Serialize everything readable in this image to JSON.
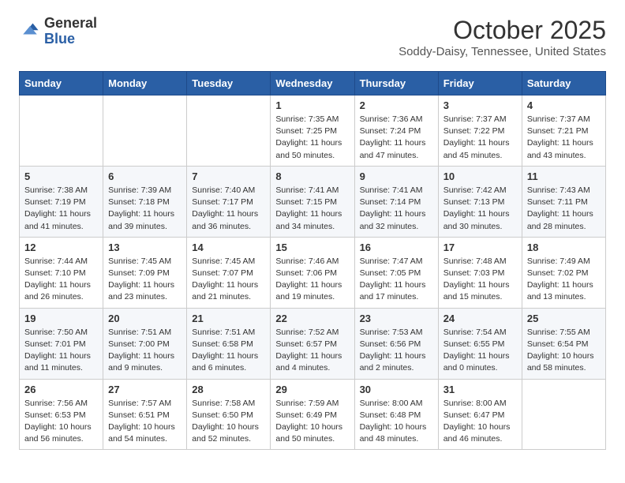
{
  "header": {
    "logo": {
      "general": "General",
      "blue": "Blue"
    },
    "title": "October 2025",
    "location": "Soddy-Daisy, Tennessee, United States"
  },
  "weekdays": [
    "Sunday",
    "Monday",
    "Tuesday",
    "Wednesday",
    "Thursday",
    "Friday",
    "Saturday"
  ],
  "weeks": [
    [
      {
        "day": "",
        "info": ""
      },
      {
        "day": "",
        "info": ""
      },
      {
        "day": "",
        "info": ""
      },
      {
        "day": "1",
        "info": "Sunrise: 7:35 AM\nSunset: 7:25 PM\nDaylight: 11 hours\nand 50 minutes."
      },
      {
        "day": "2",
        "info": "Sunrise: 7:36 AM\nSunset: 7:24 PM\nDaylight: 11 hours\nand 47 minutes."
      },
      {
        "day": "3",
        "info": "Sunrise: 7:37 AM\nSunset: 7:22 PM\nDaylight: 11 hours\nand 45 minutes."
      },
      {
        "day": "4",
        "info": "Sunrise: 7:37 AM\nSunset: 7:21 PM\nDaylight: 11 hours\nand 43 minutes."
      }
    ],
    [
      {
        "day": "5",
        "info": "Sunrise: 7:38 AM\nSunset: 7:19 PM\nDaylight: 11 hours\nand 41 minutes."
      },
      {
        "day": "6",
        "info": "Sunrise: 7:39 AM\nSunset: 7:18 PM\nDaylight: 11 hours\nand 39 minutes."
      },
      {
        "day": "7",
        "info": "Sunrise: 7:40 AM\nSunset: 7:17 PM\nDaylight: 11 hours\nand 36 minutes."
      },
      {
        "day": "8",
        "info": "Sunrise: 7:41 AM\nSunset: 7:15 PM\nDaylight: 11 hours\nand 34 minutes."
      },
      {
        "day": "9",
        "info": "Sunrise: 7:41 AM\nSunset: 7:14 PM\nDaylight: 11 hours\nand 32 minutes."
      },
      {
        "day": "10",
        "info": "Sunrise: 7:42 AM\nSunset: 7:13 PM\nDaylight: 11 hours\nand 30 minutes."
      },
      {
        "day": "11",
        "info": "Sunrise: 7:43 AM\nSunset: 7:11 PM\nDaylight: 11 hours\nand 28 minutes."
      }
    ],
    [
      {
        "day": "12",
        "info": "Sunrise: 7:44 AM\nSunset: 7:10 PM\nDaylight: 11 hours\nand 26 minutes."
      },
      {
        "day": "13",
        "info": "Sunrise: 7:45 AM\nSunset: 7:09 PM\nDaylight: 11 hours\nand 23 minutes."
      },
      {
        "day": "14",
        "info": "Sunrise: 7:45 AM\nSunset: 7:07 PM\nDaylight: 11 hours\nand 21 minutes."
      },
      {
        "day": "15",
        "info": "Sunrise: 7:46 AM\nSunset: 7:06 PM\nDaylight: 11 hours\nand 19 minutes."
      },
      {
        "day": "16",
        "info": "Sunrise: 7:47 AM\nSunset: 7:05 PM\nDaylight: 11 hours\nand 17 minutes."
      },
      {
        "day": "17",
        "info": "Sunrise: 7:48 AM\nSunset: 7:03 PM\nDaylight: 11 hours\nand 15 minutes."
      },
      {
        "day": "18",
        "info": "Sunrise: 7:49 AM\nSunset: 7:02 PM\nDaylight: 11 hours\nand 13 minutes."
      }
    ],
    [
      {
        "day": "19",
        "info": "Sunrise: 7:50 AM\nSunset: 7:01 PM\nDaylight: 11 hours\nand 11 minutes."
      },
      {
        "day": "20",
        "info": "Sunrise: 7:51 AM\nSunset: 7:00 PM\nDaylight: 11 hours\nand 9 minutes."
      },
      {
        "day": "21",
        "info": "Sunrise: 7:51 AM\nSunset: 6:58 PM\nDaylight: 11 hours\nand 6 minutes."
      },
      {
        "day": "22",
        "info": "Sunrise: 7:52 AM\nSunset: 6:57 PM\nDaylight: 11 hours\nand 4 minutes."
      },
      {
        "day": "23",
        "info": "Sunrise: 7:53 AM\nSunset: 6:56 PM\nDaylight: 11 hours\nand 2 minutes."
      },
      {
        "day": "24",
        "info": "Sunrise: 7:54 AM\nSunset: 6:55 PM\nDaylight: 11 hours\nand 0 minutes."
      },
      {
        "day": "25",
        "info": "Sunrise: 7:55 AM\nSunset: 6:54 PM\nDaylight: 10 hours\nand 58 minutes."
      }
    ],
    [
      {
        "day": "26",
        "info": "Sunrise: 7:56 AM\nSunset: 6:53 PM\nDaylight: 10 hours\nand 56 minutes."
      },
      {
        "day": "27",
        "info": "Sunrise: 7:57 AM\nSunset: 6:51 PM\nDaylight: 10 hours\nand 54 minutes."
      },
      {
        "day": "28",
        "info": "Sunrise: 7:58 AM\nSunset: 6:50 PM\nDaylight: 10 hours\nand 52 minutes."
      },
      {
        "day": "29",
        "info": "Sunrise: 7:59 AM\nSunset: 6:49 PM\nDaylight: 10 hours\nand 50 minutes."
      },
      {
        "day": "30",
        "info": "Sunrise: 8:00 AM\nSunset: 6:48 PM\nDaylight: 10 hours\nand 48 minutes."
      },
      {
        "day": "31",
        "info": "Sunrise: 8:00 AM\nSunset: 6:47 PM\nDaylight: 10 hours\nand 46 minutes."
      },
      {
        "day": "",
        "info": ""
      }
    ]
  ]
}
